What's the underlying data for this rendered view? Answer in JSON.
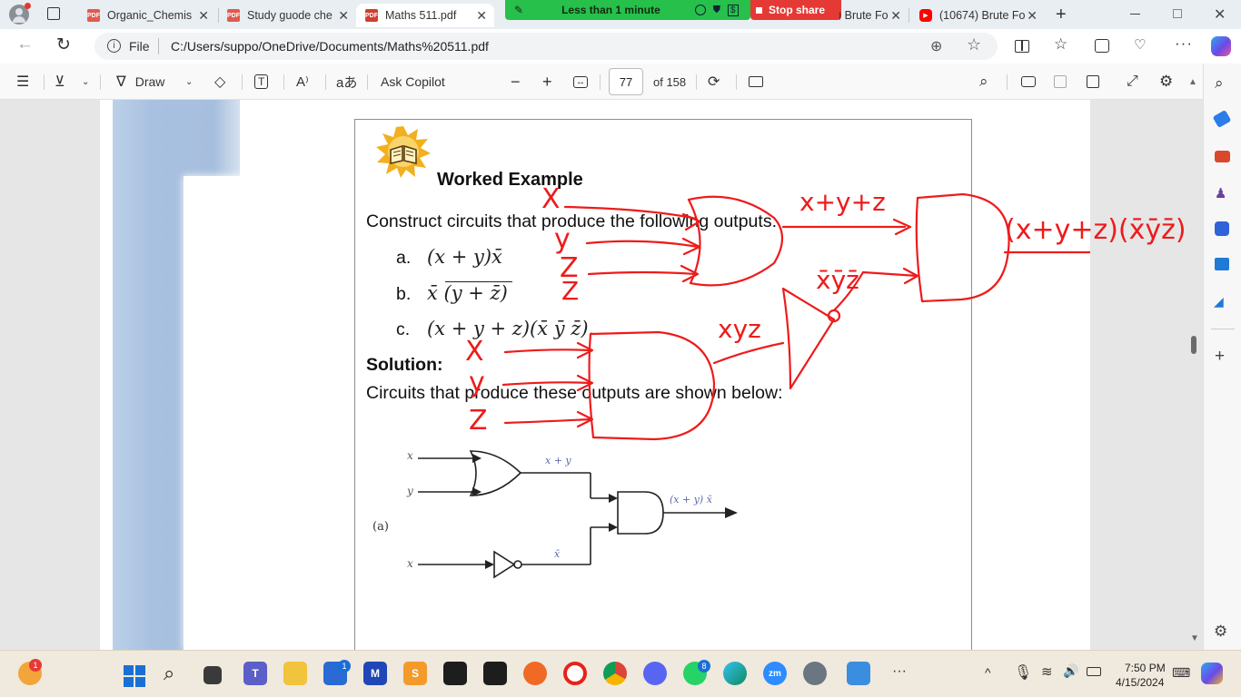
{
  "tabs": [
    {
      "title": "Organic_Chemis",
      "active": false
    },
    {
      "title": "Study guode che",
      "active": false
    },
    {
      "title": "Maths 511.pdf",
      "active": true
    },
    {
      "title": ") Brute Fo",
      "active": false
    },
    {
      "title": "(10674) Brute Fo",
      "active": false
    }
  ],
  "share_bar": {
    "label": "Less than 1 minute",
    "stop_label": "Stop share"
  },
  "address": {
    "scheme_label": "File",
    "url": "C:/Users/suppo/OneDrive/Documents/Maths%20511.pdf"
  },
  "pdf_toolbar": {
    "draw_label": "Draw",
    "ask_copilot_label": "Ask Copilot",
    "page_current": "77",
    "page_total_label": "of 158"
  },
  "document": {
    "heading": "Worked Example",
    "prompt": "Construct circuits that produce the following outputs:",
    "items": [
      {
        "letter": "a.",
        "expr": "(x + y)x̄"
      },
      {
        "letter": "b.",
        "expr": "x̄ (y + z̄)"
      },
      {
        "letter": "c.",
        "expr": "(x + y + z)(x̄ ȳ z̄)."
      }
    ],
    "solution_label": "Solution:",
    "solution_text": "Circuits that produce these outputs are shown below:",
    "figure": {
      "part_label": "(a)",
      "input_x": "x",
      "input_y": "y",
      "input_x2": "x",
      "or_label": "x + y",
      "not_label": "x̄",
      "and_label": "(x + y) x̄"
    }
  },
  "annotations": {
    "x_top": "X",
    "y_top": "y",
    "z_top": "Z",
    "z_mid": "Z",
    "sum": "x+y+z",
    "complement": "x̄ȳz̄",
    "result": "(x+y+z)(x̄ȳz̄)",
    "x_bot": "X",
    "y_bot": "y",
    "z_bot": "Z",
    "xyz": "xyz"
  },
  "taskbar": {
    "time": "7:50 PM",
    "date": "4/15/2024",
    "badges": {
      "weather": "1",
      "store": "1",
      "whatsapp": "8"
    }
  },
  "colors": {
    "ink": "#ee1b1b",
    "share_green": "#26c04a",
    "stop_red": "#e53935",
    "accent": "#0067c0"
  }
}
